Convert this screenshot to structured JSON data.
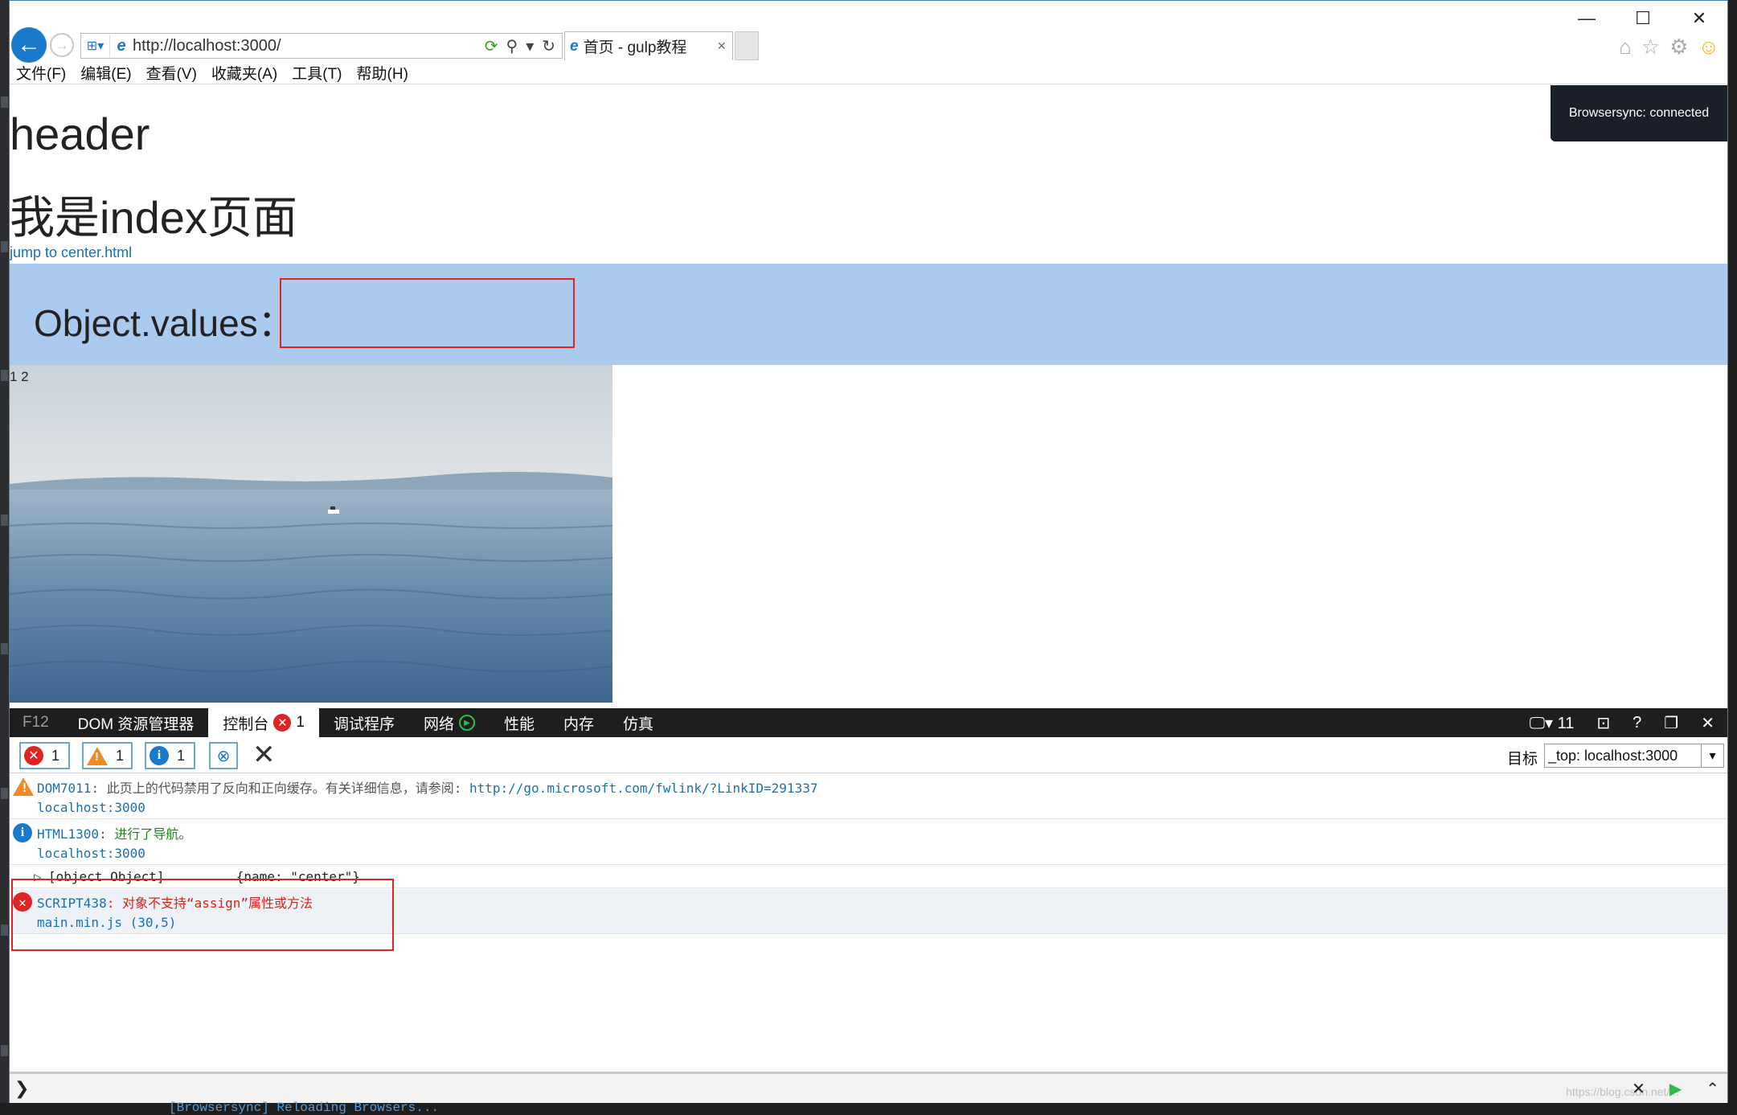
{
  "browser": {
    "url": "http://localhost:3000/",
    "tab_title": "首页 - gulp教程",
    "tab_close": "×",
    "menu": [
      "文件(F)",
      "编辑(E)",
      "查看(V)",
      "收藏夹(A)",
      "工具(T)",
      "帮助(H)"
    ],
    "window_controls": [
      "—",
      "☐",
      "✕"
    ]
  },
  "page": {
    "browsersync": "Browsersync: connected",
    "header": "header",
    "index_title": "我是index页面",
    "jump_link": "jump to center.html",
    "object_values_label": "Object.values：",
    "numbers": "1 2"
  },
  "devtools": {
    "f12": "F12",
    "tabs": [
      "DOM 资源管理器",
      "控制台",
      "调试程序",
      "网络",
      "性能",
      "内存",
      "仿真"
    ],
    "console_error_badge": "1",
    "doc_mode": "11",
    "filters": {
      "errors": "1",
      "warnings": "1",
      "info": "1"
    },
    "target_label": "目标",
    "target_value": "_top: localhost:3000",
    "messages": {
      "warn_code": "DOM7011",
      "warn_text": ": 此页上的代码禁用了反向和正向缓存。有关详细信息，请参阅: ",
      "warn_link": "http://go.microsoft.com/fwlink/?LinkID=291337",
      "warn_source": "localhost:3000",
      "info_code": "HTML1300",
      "info_text": ": 进行了导航。",
      "info_source": "localhost:3000",
      "obj_label": "[object Object]",
      "obj_value": "{name: \"center\"}",
      "err_code": "SCRIPT438",
      "err_text": ": 对象不支持“assign”属性或方法",
      "err_source": "main.min.js (30,5)"
    },
    "prompt": "❯",
    "watermark": "https://blog.csdn.net/..."
  },
  "background": {
    "terminal_line": "[Browsersync] Reloading Browsers..."
  }
}
